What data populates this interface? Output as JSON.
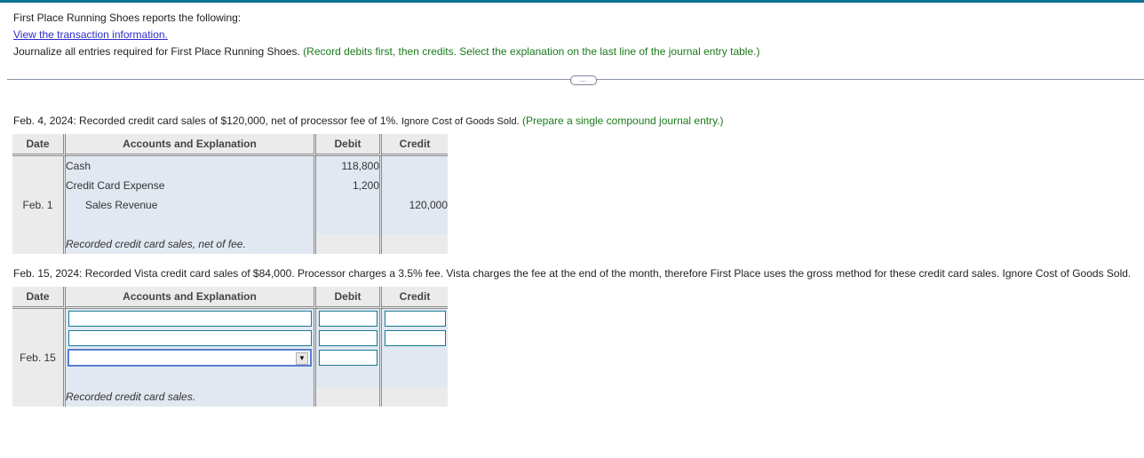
{
  "header": {
    "intro": "First Place Running Shoes reports the following:",
    "link": "View the transaction information.",
    "instruction": "Journalize all entries required for First Place Running Shoes.",
    "instruction_hint": "(Record debits first, then credits. Select the explanation on the last line of the journal entry table.)",
    "more_button": "…"
  },
  "entry1": {
    "prompt": "Feb. 4, 2024: Recorded credit card sales of $120,000, net of processor fee of 1%.",
    "prompt_small": "Ignore Cost of Goods Sold.",
    "prompt_hint": "(Prepare a single compound journal entry.)",
    "columns": [
      "Date",
      "Accounts and Explanation",
      "Debit",
      "Credit"
    ],
    "date": "Feb. 1",
    "rows": [
      {
        "account": "Cash",
        "debit": "118,800",
        "credit": ""
      },
      {
        "account": "Credit Card Expense",
        "debit": "1,200",
        "credit": ""
      },
      {
        "account": "Sales Revenue",
        "debit": "",
        "credit": "120,000"
      }
    ],
    "explanation": "Recorded credit card sales, net of fee."
  },
  "entry2": {
    "prompt": "Feb. 15, 2024: Recorded Vista credit card sales of $84,000. Processor charges a 3.5% fee. Vista charges the fee at the end of the month, therefore First Place uses the gross method for these credit card sales. Ignore Cost of Goods Sold.",
    "columns": [
      "Date",
      "Accounts and Explanation",
      "Debit",
      "Credit"
    ],
    "date": "Feb. 15",
    "rows": [
      {
        "account": "",
        "debit": "",
        "credit": ""
      },
      {
        "account": "",
        "debit": "",
        "credit": ""
      },
      {
        "account_select": "",
        "debit": ""
      }
    ],
    "explanation": "Recorded credit card sales."
  },
  "colors": {
    "topbar": "#0e7194",
    "hint_green": "#1a7a1a",
    "link_blue": "#2e2ecc",
    "input_border": "#1a7a92",
    "cell_blue": "#e1e8f2",
    "cell_gray": "#ebebeb"
  }
}
